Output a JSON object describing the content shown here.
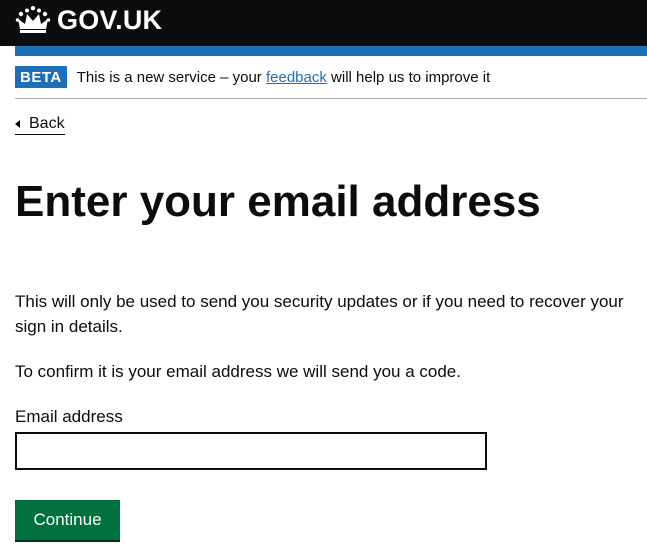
{
  "header": {
    "title": "GOV.UK",
    "logo_icon": "crown-icon",
    "background_color": "#0b0c0c",
    "stripe_color": "#1d70b8"
  },
  "phase_banner": {
    "tag": "BETA",
    "text_before": "This is a new service – your ",
    "link_text": "feedback",
    "text_after": " will help us to improve it"
  },
  "back_link": {
    "label": "Back",
    "icon": "triangle-left-icon"
  },
  "main": {
    "title": "Enter your email address",
    "paragraphs": [
      "This will only be used to send you security updates or if you need to recover your sign in details.",
      "To confirm it is your email address we will send you a code."
    ]
  },
  "form": {
    "email_label": "Email address",
    "email_value": "",
    "continue_label": "Continue",
    "continue_color": "#00703c"
  }
}
